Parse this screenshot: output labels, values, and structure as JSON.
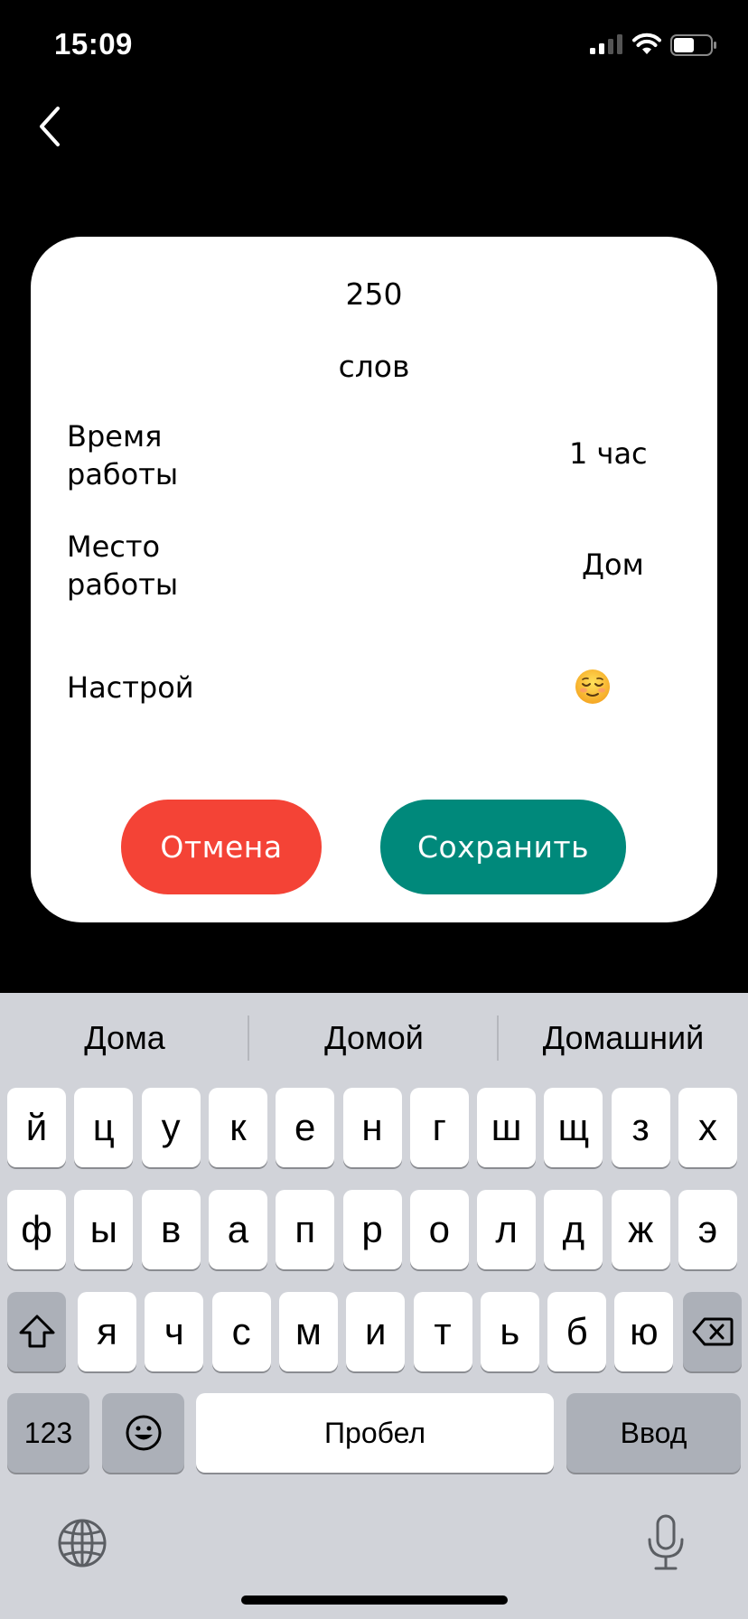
{
  "status_bar": {
    "time": "15:09"
  },
  "card": {
    "count": "250",
    "unit": "слов",
    "rows": [
      {
        "label": "Время работы",
        "value": "1 час"
      },
      {
        "label": "Место работы",
        "value": "Дом"
      },
      {
        "label": "Настрой",
        "value_icon": "relieved-face-emoji"
      }
    ],
    "cancel_label": "Отмена",
    "save_label": "Сохранить"
  },
  "keyboard": {
    "suggestions": [
      "Дома",
      "Домой",
      "Домашний"
    ],
    "row1": [
      "й",
      "ц",
      "у",
      "к",
      "е",
      "н",
      "г",
      "ш",
      "щ",
      "з",
      "х"
    ],
    "row2": [
      "ф",
      "ы",
      "в",
      "а",
      "п",
      "р",
      "о",
      "л",
      "д",
      "ж",
      "э"
    ],
    "row3": [
      "я",
      "ч",
      "с",
      "м",
      "и",
      "т",
      "ь",
      "б",
      "ю"
    ],
    "numbers_label": "123",
    "space_label": "Пробел",
    "return_label": "Ввод"
  },
  "colors": {
    "cancel": "#f44336",
    "save": "#00897b",
    "keyboard_bg": "#d1d3d9"
  }
}
